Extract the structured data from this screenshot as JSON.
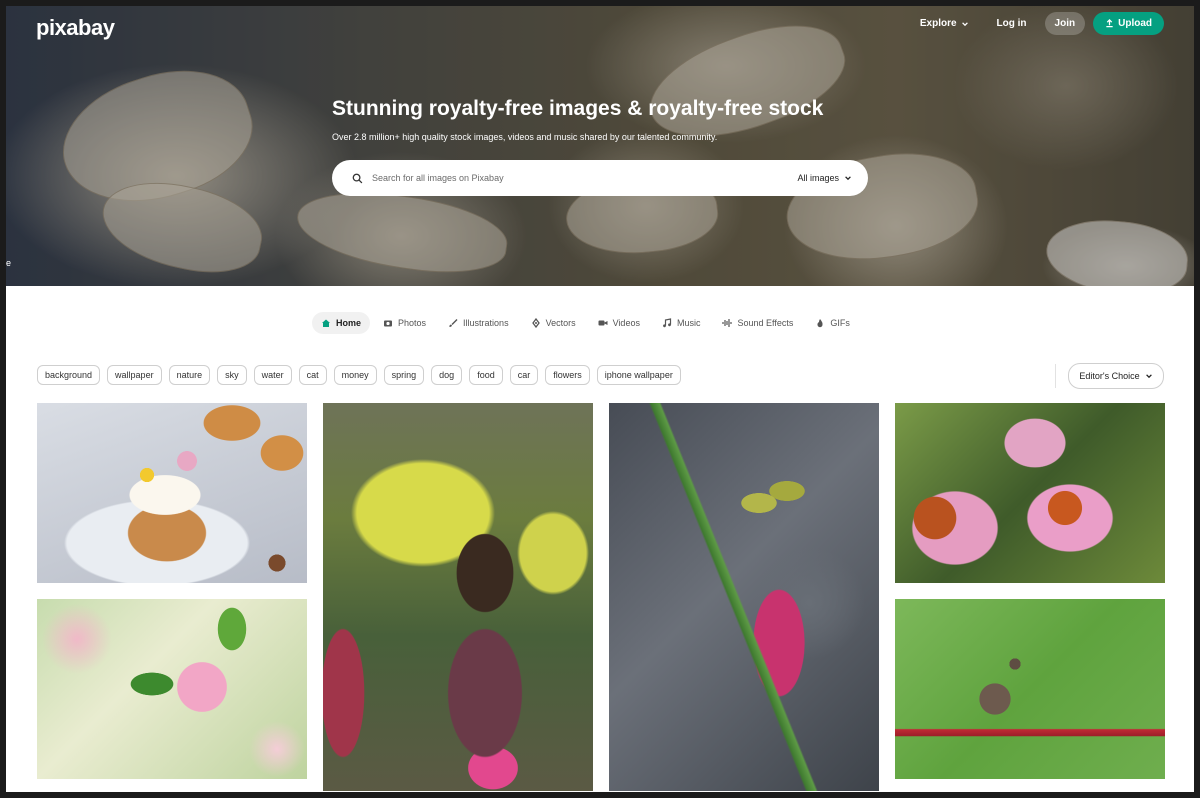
{
  "brand": {
    "logo": "pixabay"
  },
  "nav": {
    "explore": "Explore",
    "login": "Log in",
    "join": "Join",
    "upload": "Upload"
  },
  "hero": {
    "title": "Stunning royalty-free images & royalty-free stock",
    "subtitle": "Over 2.8 million+ high quality stock images, videos and music shared by our talented community.",
    "edge_char": "e"
  },
  "search": {
    "placeholder": "Search for all images on Pixabay",
    "filter": "All images"
  },
  "tabs": [
    {
      "label": "Home",
      "icon": "home-icon"
    },
    {
      "label": "Photos",
      "icon": "camera-icon"
    },
    {
      "label": "Illustrations",
      "icon": "brush-icon"
    },
    {
      "label": "Vectors",
      "icon": "pen-nib-icon"
    },
    {
      "label": "Videos",
      "icon": "video-icon"
    },
    {
      "label": "Music",
      "icon": "music-icon"
    },
    {
      "label": "Sound Effects",
      "icon": "waveform-icon"
    },
    {
      "label": "GIFs",
      "icon": "flame-icon"
    }
  ],
  "chips": [
    "background",
    "wallpaper",
    "nature",
    "sky",
    "water",
    "cat",
    "money",
    "spring",
    "dog",
    "food",
    "car",
    "flowers",
    "iphone wallpaper"
  ],
  "sort": {
    "label": "Editor's Choice"
  },
  "colors": {
    "accent": "#05a081"
  }
}
